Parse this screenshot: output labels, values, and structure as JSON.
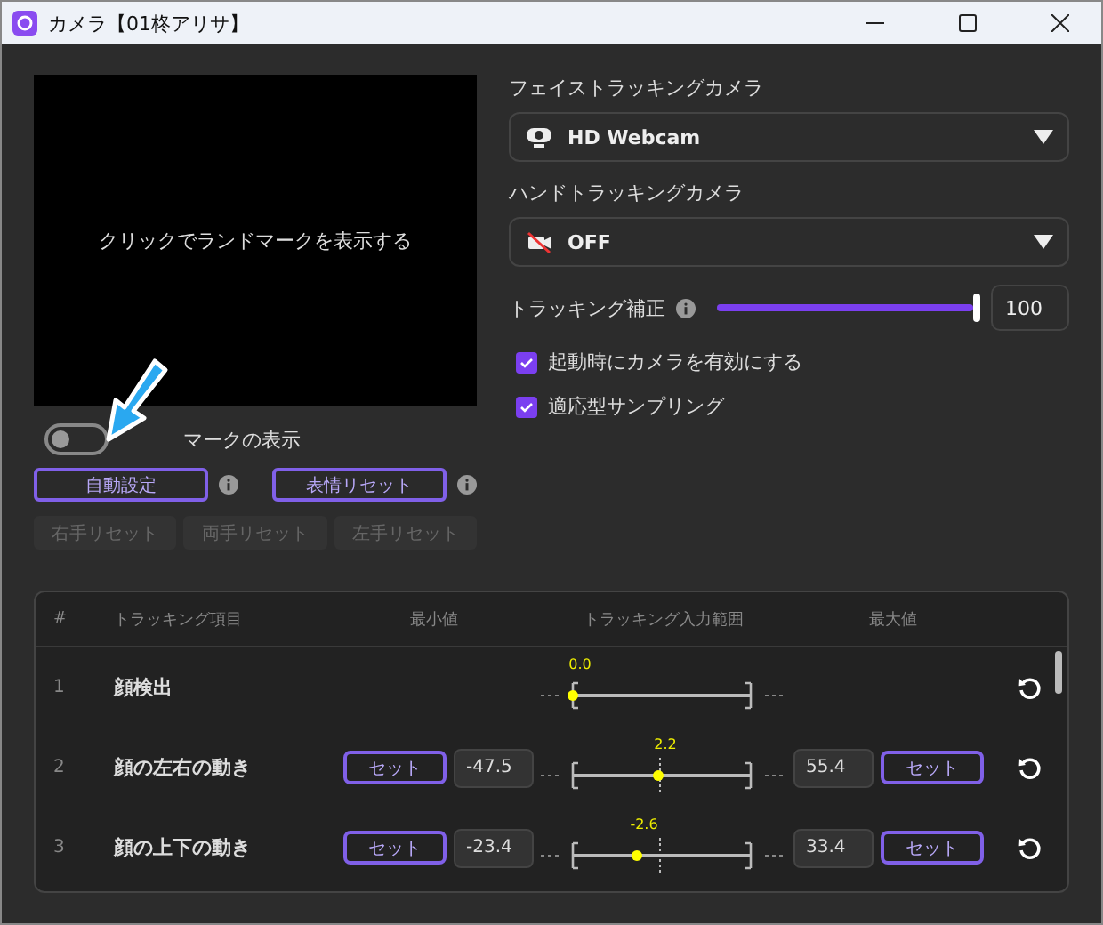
{
  "window": {
    "title": "カメラ【01柊アリサ】"
  },
  "preview": {
    "text": "クリックでランドマークを表示する"
  },
  "landmark_toggle": {
    "label": "マークの表示",
    "on": false
  },
  "action_buttons": [
    {
      "label": "自動設定"
    },
    {
      "label": "表情リセット"
    }
  ],
  "hand_resets": [
    {
      "label": "右手リセット",
      "disabled": true
    },
    {
      "label": "両手リセット",
      "disabled": true
    },
    {
      "label": "左手リセット",
      "disabled": true
    }
  ],
  "face_camera": {
    "label": "フェイストラッキングカメラ",
    "value": "HD Webcam"
  },
  "hand_camera": {
    "label": "ハンドトラッキングカメラ",
    "value": "OFF"
  },
  "correction": {
    "label": "トラッキング補正",
    "level": 1,
    "value": "100"
  },
  "options": [
    {
      "label": "起動時にカメラを有効にする",
      "checked": true
    },
    {
      "label": "適応型サンプリング",
      "checked": true
    }
  ],
  "table": {
    "columns": [
      "#",
      "トラッキング項目",
      "最小値",
      "トラッキング入力範囲",
      "最大値"
    ],
    "rows": [
      {
        "kind": "detect",
        "index": "1",
        "name": "顔検出",
        "reading": "0.0",
        "level": 0
      },
      {
        "kind": "range",
        "index": "2",
        "name": "顔の左右の動き",
        "set_min": "セット",
        "min": "-47.5",
        "reading": "2.2",
        "level": 0.48,
        "max": "55.4",
        "set_max": "セット"
      },
      {
        "kind": "range",
        "index": "3",
        "name": "顔の上下の動き",
        "set_min": "セット",
        "min": "-23.4",
        "reading": "-2.6",
        "level": 0.36,
        "max": "33.4",
        "set_max": "セット"
      }
    ]
  }
}
